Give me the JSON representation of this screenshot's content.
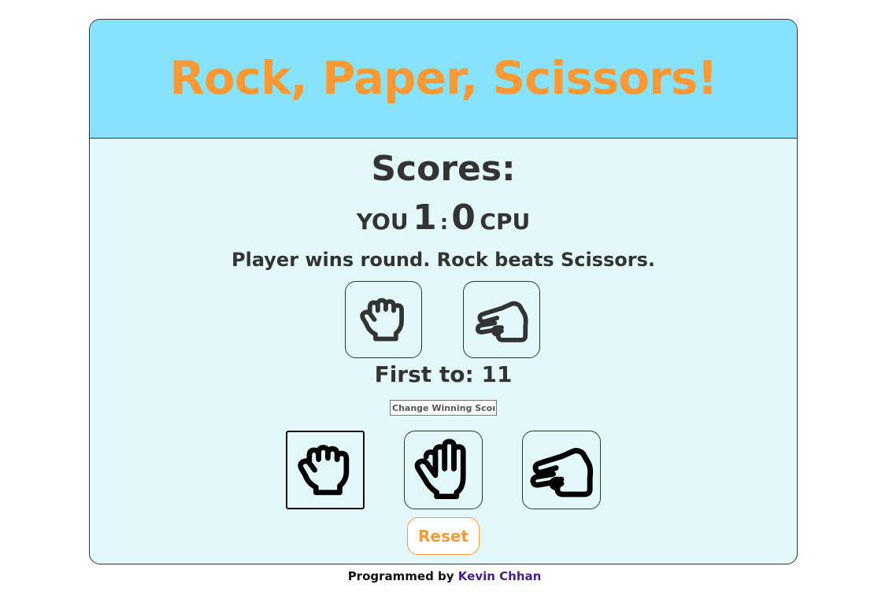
{
  "header": {
    "title": "Rock, Paper, Scissors!"
  },
  "scoreboard": {
    "heading": "Scores:",
    "player_label": "YOU",
    "player_score": "1",
    "separator": ":",
    "cpu_score": "0",
    "cpu_label": "CPU"
  },
  "round": {
    "result_text": "Player wins round. Rock beats Scissors.",
    "player_choice_icon": "rock-icon",
    "cpu_choice_icon": "scissors-icon"
  },
  "settings": {
    "first_to_label": "First to: 11",
    "winning_score_placeholder": "Change Winning Score"
  },
  "choices": [
    {
      "name": "rock",
      "icon": "rock-icon"
    },
    {
      "name": "paper",
      "icon": "paper-icon"
    },
    {
      "name": "scissors",
      "icon": "scissors-icon"
    }
  ],
  "controls": {
    "reset_label": "Reset"
  },
  "footer": {
    "prefix": "Programmed by ",
    "author": "Kevin Chhan"
  },
  "colors": {
    "header_bg": "#87e3fb",
    "card_bg": "#e3f9f9",
    "accent_orange": "#fb9a35",
    "text_dark": "#333333",
    "link_purple": "#4b1f8a"
  }
}
